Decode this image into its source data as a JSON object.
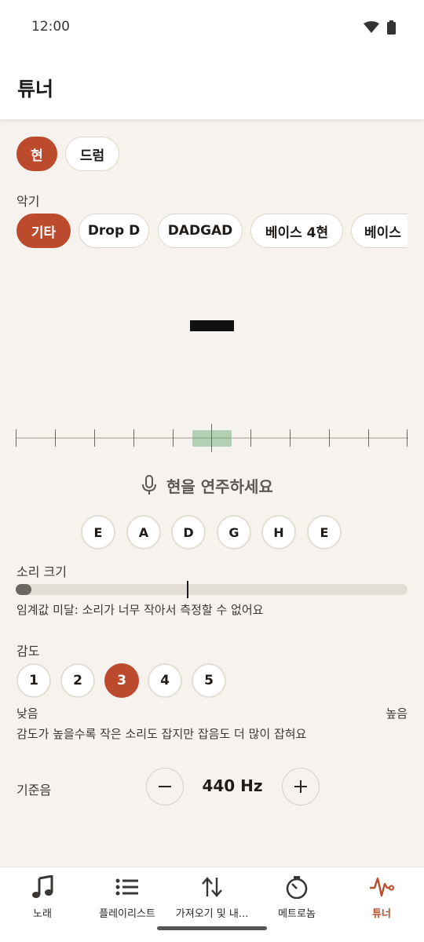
{
  "status_bar": {
    "time": "12:00"
  },
  "app_bar": {
    "title": "튜너"
  },
  "mode_tabs": [
    {
      "label": "현",
      "active": true
    },
    {
      "label": "드럼",
      "active": false
    }
  ],
  "instrument": {
    "label": "악기",
    "options": [
      {
        "label": "기타",
        "active": true
      },
      {
        "label": "Drop D",
        "active": false
      },
      {
        "label": "DADGAD",
        "active": false
      },
      {
        "label": "베이스 4현",
        "active": false
      },
      {
        "label": "베이스",
        "active": false
      }
    ]
  },
  "prompt": {
    "text": "현을 연주하세요"
  },
  "strings": [
    "E",
    "A",
    "D",
    "G",
    "H",
    "E"
  ],
  "volume": {
    "label": "소리 크기",
    "level_fraction": 0.04,
    "threshold_fraction": 0.44,
    "message": "임계값 미달: 소리가 너무 작아서 측정할 수 없어요"
  },
  "sensitivity": {
    "label": "감도",
    "levels": [
      "1",
      "2",
      "3",
      "4",
      "5"
    ],
    "selected": "3",
    "low_label": "낮음",
    "high_label": "높음",
    "description": "감도가 높을수록 작은 소리도 잡지만 잡음도 더 많이 잡혀요"
  },
  "reference": {
    "label": "기준음",
    "value": "440 Hz"
  },
  "bottom_nav": [
    {
      "label": "노래",
      "icon": "music-note-icon",
      "active": false
    },
    {
      "label": "플레이리스트",
      "icon": "list-icon",
      "active": false
    },
    {
      "label": "가져오기 및 내...",
      "icon": "import-export-icon",
      "active": false
    },
    {
      "label": "메트로놈",
      "icon": "metronome-icon",
      "active": false
    },
    {
      "label": "튜너",
      "icon": "tuner-wave-icon",
      "active": true
    }
  ],
  "colors": {
    "accent": "#bc4a2c",
    "background": "#f6f3ee",
    "in_tune_zone": "#60a86c"
  }
}
